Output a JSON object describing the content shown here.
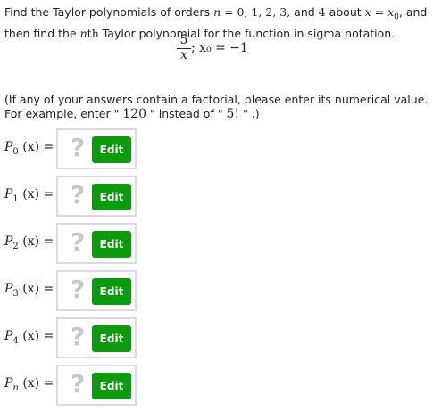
{
  "problem": {
    "line1_part1": "Find the Taylor polynomials of orders ",
    "line1_n": "n",
    "line1_eq": " = 0, 1, 2, 3, ",
    "line1_and": "and ",
    "line1_four": "4",
    "line1_about": " about ",
    "line1_x": "x",
    "line1_eq2": " = ",
    "line1_x0": "x",
    "line1_x0_sub": "0",
    "line1_end": ", and",
    "line2_part1": "then find the ",
    "line2_n": "n",
    "line2_th": "th",
    "line2_part2": " Taylor polynomial for the function in sigma notation.",
    "function_numerator": "5",
    "function_denominator": "x",
    "function_tail": "; x₀ = −1"
  },
  "note": {
    "line1": "(If any of your answers contain a factorial, please enter its numerical value.",
    "line2_part1": "For example, enter \" ",
    "line2_num": "120",
    "line2_part2": " \" instead of \" ",
    "line2_fact": "5!",
    "line2_part3": " \" .)"
  },
  "answers": [
    {
      "label": "P",
      "sub": "0",
      "arg": " (x) =",
      "placeholder": "?",
      "button": "Edit"
    },
    {
      "label": "P",
      "sub": "1",
      "arg": " (x) =",
      "placeholder": "?",
      "button": "Edit"
    },
    {
      "label": "P",
      "sub": "2",
      "arg": " (x) =",
      "placeholder": "?",
      "button": "Edit"
    },
    {
      "label": "P",
      "sub": "3",
      "arg": " (x) =",
      "placeholder": "?",
      "button": "Edit"
    },
    {
      "label": "P",
      "sub": "4",
      "arg": " (x) =",
      "placeholder": "?",
      "button": "Edit"
    },
    {
      "label": "P",
      "sub": "n",
      "arg": " (x) =",
      "placeholder": "?",
      "button": "Edit"
    }
  ],
  "colors": {
    "edit_button": "#0c9b0c",
    "placeholder": "#c8c8c8",
    "box_border": "#dcdcdc"
  }
}
